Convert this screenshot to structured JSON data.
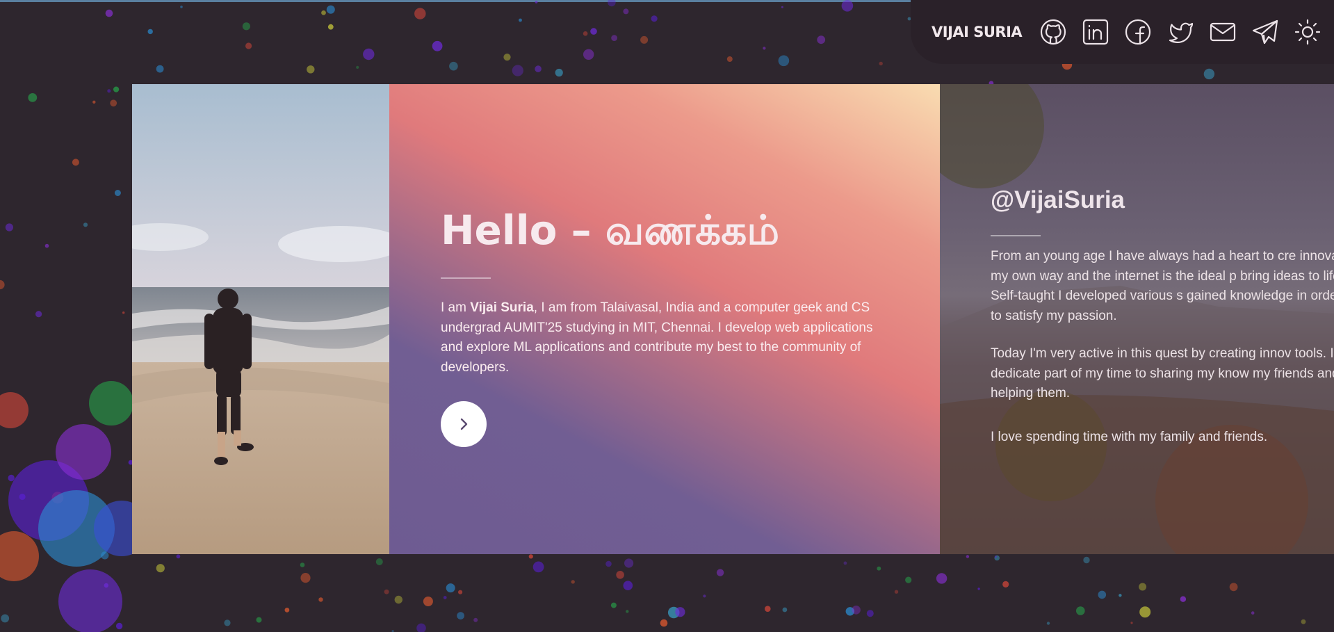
{
  "nav": {
    "brand": "VIJAI SURIA",
    "icons": [
      "github-icon",
      "linkedin-icon",
      "facebook-icon",
      "twitter-icon",
      "mail-icon",
      "telegram-icon",
      "sun-icon"
    ]
  },
  "hero": {
    "title": "Hello – வணக்கம்",
    "intro_prefix": "I am ",
    "intro_name": "Vijai Suria",
    "intro_rest": ", I am from Talaivasal, India and a computer geek and CS undergrad AUMIT'25 studying in MIT, Chennai. I develop web applications and explore ML applications and contribute my best to the community of developers.",
    "next_button_icon": "chevron-right-icon"
  },
  "about": {
    "handle": "@VijaiSuria",
    "paragraphs": [
      "From an young age I have always had a heart to cre innovate my own way and the internet is the ideal p bring ideas to life. Self-taught I developed various s gained knowledge in order to satisfy my passion.",
      "Today I'm very active in this quest by creating innov tools. I dedicate part of my time to sharing my know my friends and helping them.",
      "I love spending time with my family and friends."
    ]
  },
  "colors": {
    "background": "#2e262e",
    "nav_background": "#2a2129",
    "gradient_purple": "#6e5b92",
    "gradient_coral": "#e07a7c",
    "gradient_peach": "#f9dcb1",
    "text_light": "#f7eaee"
  }
}
